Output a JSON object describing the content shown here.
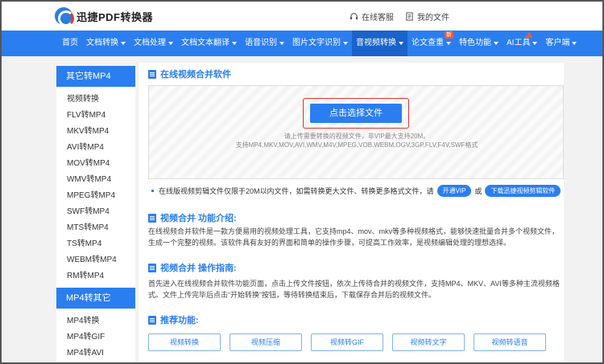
{
  "header": {
    "logo_text": "迅捷PDF转换器",
    "service_label": "在线客服",
    "my_files_label": "我的文件"
  },
  "nav": [
    {
      "label": "首页",
      "caret": false
    },
    {
      "label": "文档转换",
      "caret": true
    },
    {
      "label": "文档处理",
      "caret": true
    },
    {
      "label": "文档文本翻译",
      "caret": true
    },
    {
      "label": "语音识别",
      "caret": true
    },
    {
      "label": "图片文字识别",
      "caret": true
    },
    {
      "label": "音视频转换",
      "caret": true,
      "active": true
    },
    {
      "label": "论文查重",
      "caret": true,
      "badge": "新"
    },
    {
      "label": "特色功能",
      "caret": true
    },
    {
      "label": "AI工具",
      "caret": true,
      "triangle": true
    },
    {
      "label": "客户端",
      "caret": true
    }
  ],
  "sidebar": {
    "group1_title": "其它转MP4",
    "group1_items": [
      "视频转换",
      "FLV转MP4",
      "MKV转MP4",
      "AVI转MP4",
      "MOV转MP4",
      "WMV转MP4",
      "MPEG转MP4",
      "SWF转MP4",
      "MTS转MP4",
      "TS转MP4",
      "WEBM转MP4",
      "RM转MP4"
    ],
    "group2_title": "MP4转其它",
    "group2_items": [
      "MP4转换",
      "MP4转GIF",
      "MP4转AVI"
    ]
  },
  "main": {
    "title": "在线视频合并软件",
    "upload_button": "点击选择文件",
    "upload_tip_line1": "请上传需要转换的视频文件，非VIP最大支持20M。",
    "upload_tip_line2": "支持MP4,MKV,MOV,AVI,WMV,M4V,MPEG,VOB,WEBM,OGV,3GP,FLV,F4V,SWF格式",
    "notice_text": "在线版视频剪辑文件仅限于20M以内文件，如需转换更大文件、转换更多格式文件，请",
    "notice_vip_button": "开通VIP",
    "notice_or": "或",
    "notice_download_button": "下载迅捷视频剪辑软件",
    "intro_title": "视频合并 功能介绍:",
    "intro_text": "在线视频合并软件是一款方便易用的视频处理工具，它支持mp4、mov、mkv等多种视频格式，能够快速批量合并多个视频文件，生成一个完整的视频。该软件具有友好的界面和简单的操作步骤，可提高工作效率，是视频编辑处理的理想选择。",
    "guide_title": "视频合并 操作指南:",
    "guide_text": "首先进入在线视频合并软件功能页面，点击上传文件按钮，依次上传待合并的视频文件，支持MP4、MKV、AVI等多种主流视频格式。文件上传完毕后点击“开始转换”按钮，等待转换结束后，下载保存合并后的视频文件。",
    "recommend_title": "推荐功能:",
    "recommend_items": [
      "视频转换",
      "视频压缩",
      "视频转GIF",
      "视频转文字",
      "视频转语音"
    ]
  },
  "colors": {
    "primary": "#2b7ef0",
    "nav_active": "#1a63cc",
    "highlight_border": "#d9342b"
  }
}
